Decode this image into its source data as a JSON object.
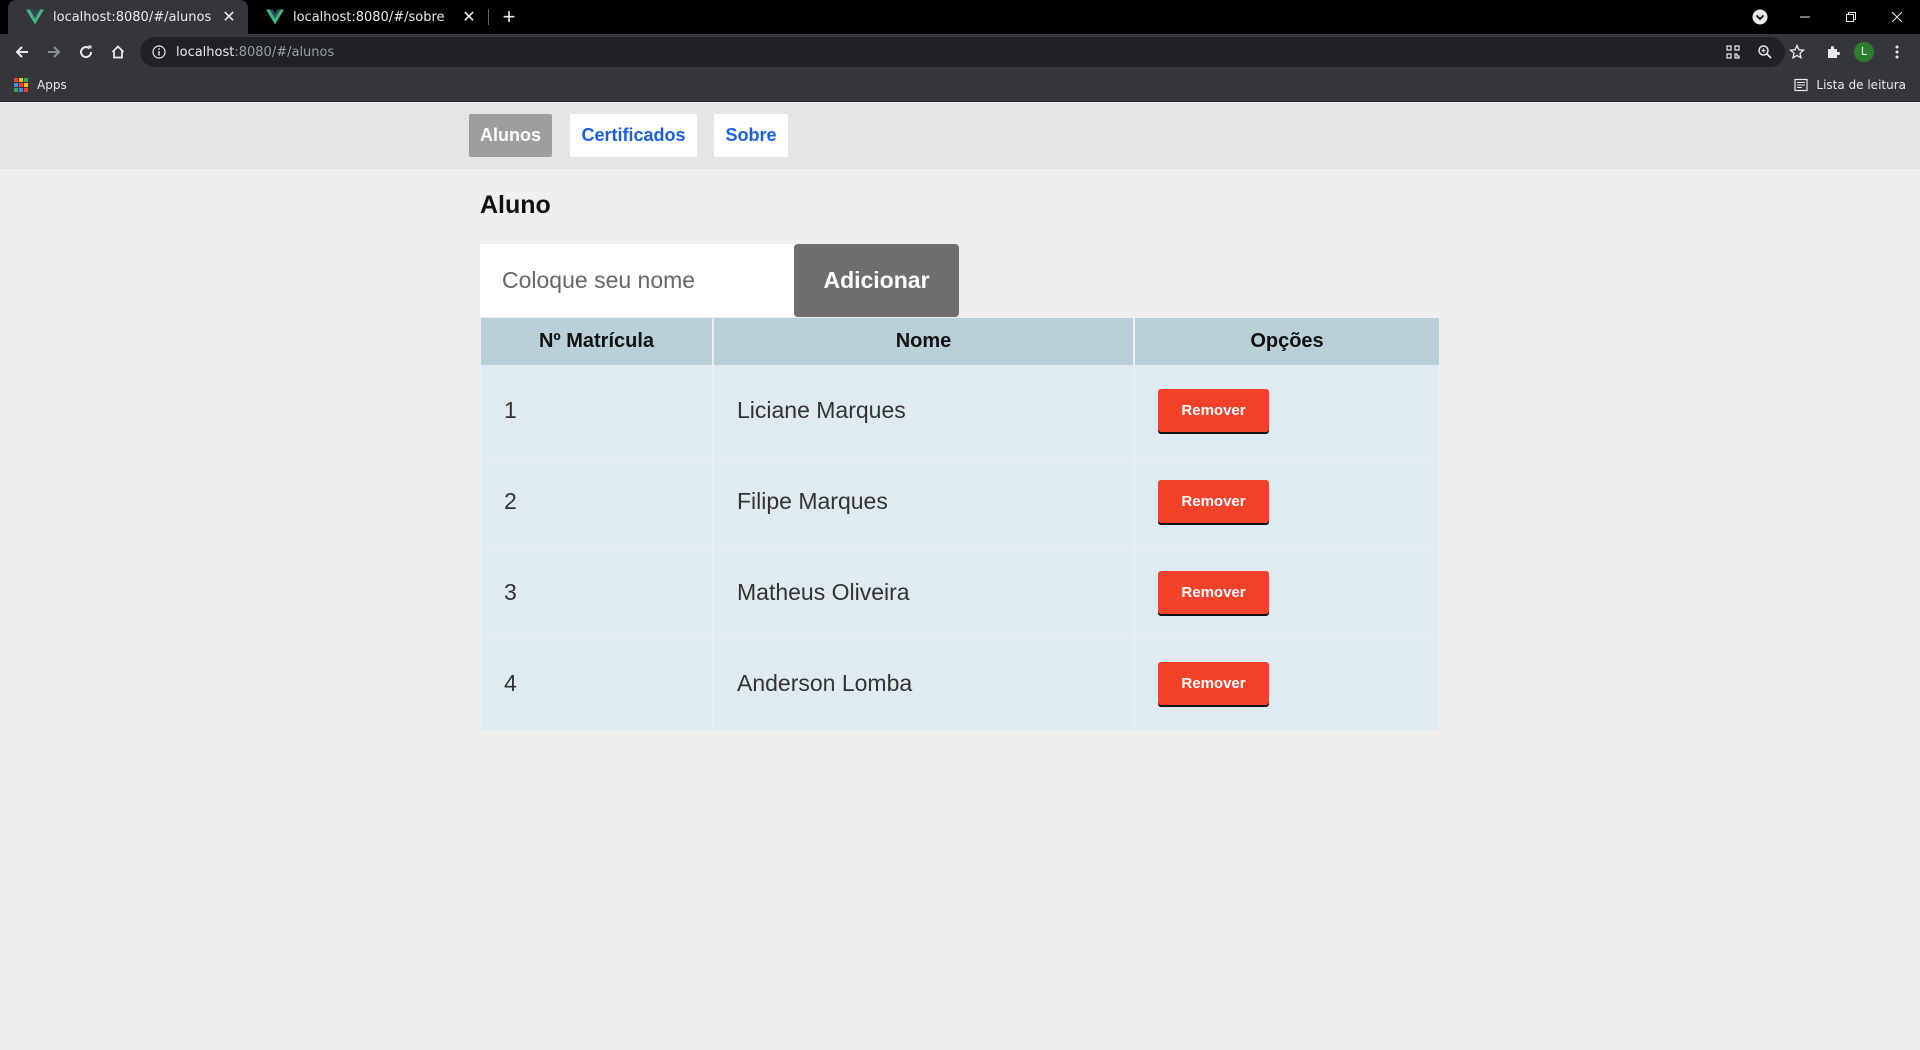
{
  "browser": {
    "tabs": [
      {
        "title": "localhost:8080/#/alunos",
        "active": true
      },
      {
        "title": "localhost:8080/#/sobre",
        "active": false
      }
    ],
    "url_host": "localhost",
    "url_rest": ":8080/#/alunos",
    "profile_initial": "L",
    "bookmarks": {
      "apps_label": "Apps",
      "reading_list_label": "Lista de leitura"
    }
  },
  "nav": {
    "links": [
      {
        "label": "Alunos",
        "active": true
      },
      {
        "label": "Certificados",
        "active": false
      },
      {
        "label": "Sobre",
        "active": false
      }
    ]
  },
  "main": {
    "title": "Aluno",
    "input_placeholder": "Coloque seu nome",
    "add_label": "Adicionar",
    "table": {
      "headers": [
        "Nº Matrícula",
        "Nome",
        "Opções"
      ],
      "rows": [
        {
          "id": "1",
          "name": "Liciane Marques",
          "action": "Remover"
        },
        {
          "id": "2",
          "name": "Filipe Marques",
          "action": "Remover"
        },
        {
          "id": "3",
          "name": "Matheus Oliveira",
          "action": "Remover"
        },
        {
          "id": "4",
          "name": "Anderson Lomba",
          "action": "Remover"
        }
      ]
    }
  },
  "colors": {
    "active_nav": "#9e9e9e",
    "link_blue": "#1a5fe0",
    "header_bg": "#b9d0d8",
    "row_bg": "#dfeaf1",
    "remove_red": "#f4412a",
    "add_button": "#6e6e6e"
  }
}
